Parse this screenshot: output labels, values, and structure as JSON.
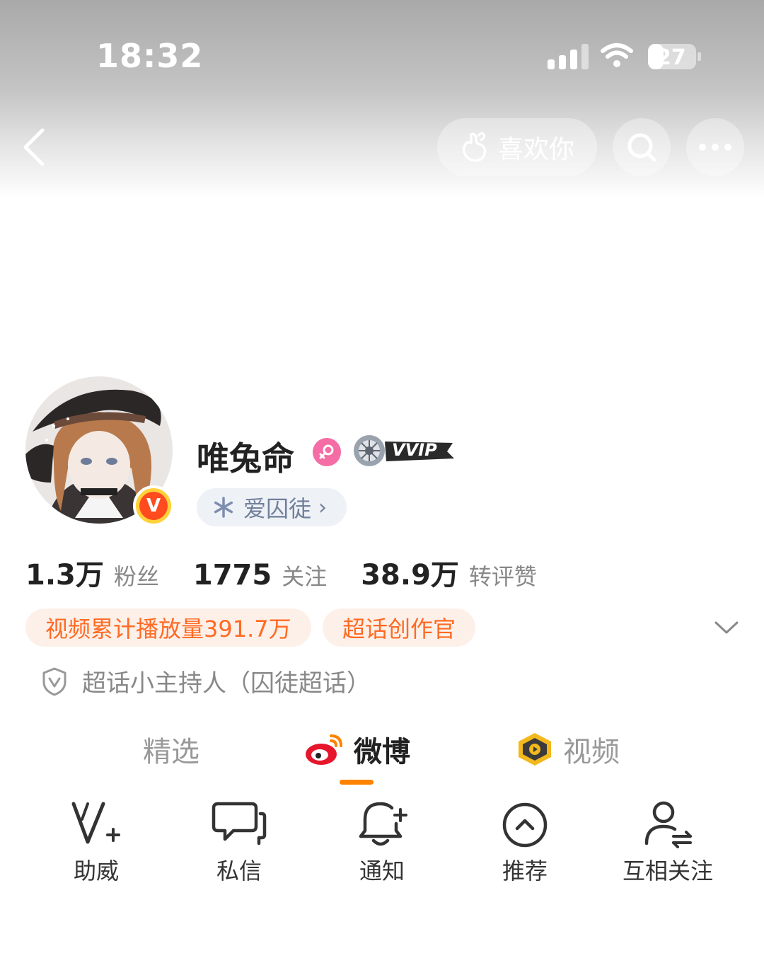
{
  "status_bar": {
    "time": "18:32",
    "battery": "27"
  },
  "header": {
    "like_label": "喜欢你"
  },
  "profile": {
    "username": "唯兔命",
    "verify_badge": "V",
    "vvip_label": "VVIP",
    "fans_group": "爱囚徒"
  },
  "stats": [
    {
      "value": "1.3万",
      "label": "粉丝"
    },
    {
      "value": "1775",
      "label": "关注"
    },
    {
      "value": "38.9万",
      "label": "转评赞"
    }
  ],
  "tags": [
    "视频累计播放量391.7万",
    "超话创作官"
  ],
  "honor": "超话小主持人（囚徒超话）",
  "tabs": [
    {
      "label": "精选"
    },
    {
      "label": "微博",
      "active": true
    },
    {
      "label": "视频"
    }
  ],
  "actions": [
    {
      "label": "助威",
      "icon": "v-plus-icon"
    },
    {
      "label": "私信",
      "icon": "message-icon"
    },
    {
      "label": "通知",
      "icon": "bell-plus-icon"
    },
    {
      "label": "推荐",
      "icon": "arrow-up-circle-icon"
    },
    {
      "label": "互相关注",
      "icon": "mutual-follow-icon"
    }
  ],
  "colors": {
    "accent": "#ff8200",
    "tag_text": "#ff6a23",
    "tag_bg": "#fdf0e9",
    "gender": "#f46da4"
  }
}
